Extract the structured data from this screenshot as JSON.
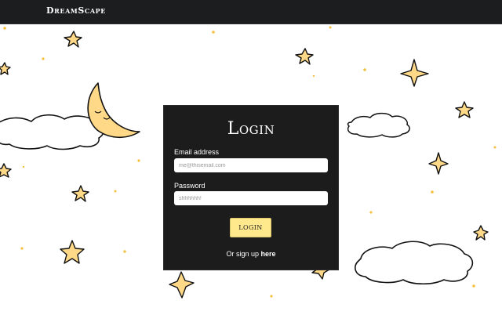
{
  "navbar": {
    "brand": "DreamScape"
  },
  "login": {
    "title": "Login",
    "email_label": "Email address",
    "email_placeholder": "me@thisemail.com",
    "password_label": "Password",
    "password_placeholder": "shhhhhh!",
    "button_label": "LOGIN",
    "signup_prefix": "Or sign up ",
    "signup_link": "here"
  },
  "colors": {
    "navbar": "#1c1d1f",
    "card": "#1c1c1c",
    "button": "#ffe98c",
    "star_fill": "#ffd987",
    "outline": "#111111",
    "dot": "#f6c03f"
  },
  "decor": {
    "stars": [
      "star-icon"
    ],
    "clouds": [
      "cloud-icon"
    ],
    "moon": "crescent-moon-icon"
  }
}
